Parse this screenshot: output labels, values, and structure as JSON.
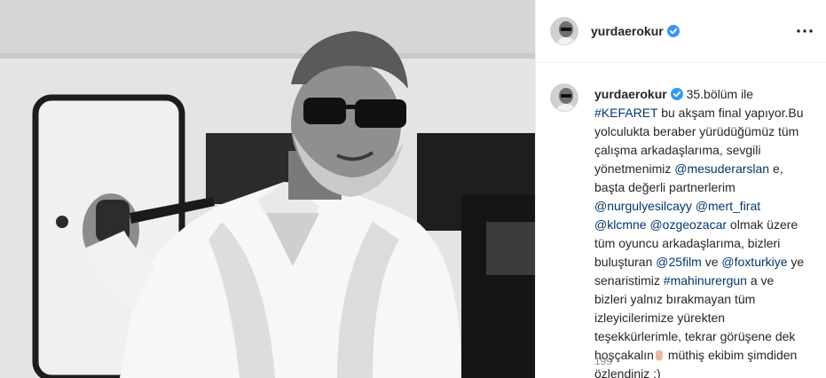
{
  "post": {
    "username": "yurdaerokur",
    "verified": true,
    "more_icon": "more-horizontal-icon",
    "time_ago": "19s"
  },
  "caption": {
    "username": "yurdaerokur",
    "segments": [
      {
        "type": "text",
        "text": " 35.bölüm ile "
      },
      {
        "type": "tag",
        "text": "#KEFARET"
      },
      {
        "type": "text",
        "text": " bu akşam final yapıyor.Bu yolculukta beraber yürüdüğümüz tüm çalışma arkadaşlarıma, sevgili yönetmenimiz "
      },
      {
        "type": "tag",
        "text": "@mesuderarslan"
      },
      {
        "type": "text",
        "text": " e, başta değerli partnerlerim "
      },
      {
        "type": "tag",
        "text": "@nurgulyesilcayy"
      },
      {
        "type": "text",
        "text": " "
      },
      {
        "type": "tag",
        "text": "@mert_firat"
      },
      {
        "type": "text",
        "text": " "
      },
      {
        "type": "tag",
        "text": "@klcmne"
      },
      {
        "type": "text",
        "text": " "
      },
      {
        "type": "tag",
        "text": "@ozgeozacar"
      },
      {
        "type": "text",
        "text": " olmak üzere tüm oyuncu arkadaşlarıma, bizleri buluşturan "
      },
      {
        "type": "tag",
        "text": "@25film"
      },
      {
        "type": "text",
        "text": " ve "
      },
      {
        "type": "tag",
        "text": "@foxturkiye"
      },
      {
        "type": "text",
        "text": " ye senaristimiz "
      },
      {
        "type": "tag",
        "text": "#mahinurergun"
      },
      {
        "type": "text",
        "text": " a ve bizleri yalnız bırakmayan tüm izleyicilerimize yürekten teşekkürlerimle, tekrar görüşene dek hoşçakalın"
      },
      {
        "type": "emoji",
        "name": "raised-hand-emoji"
      },
      {
        "type": "text",
        "text": " müthiş ekibim şimdiden özlendiniz :)"
      }
    ]
  },
  "colors": {
    "text": "#262626",
    "tag": "#00376b",
    "muted": "#8e8e8e",
    "verified": "#3897f0",
    "border": "#efefef"
  }
}
